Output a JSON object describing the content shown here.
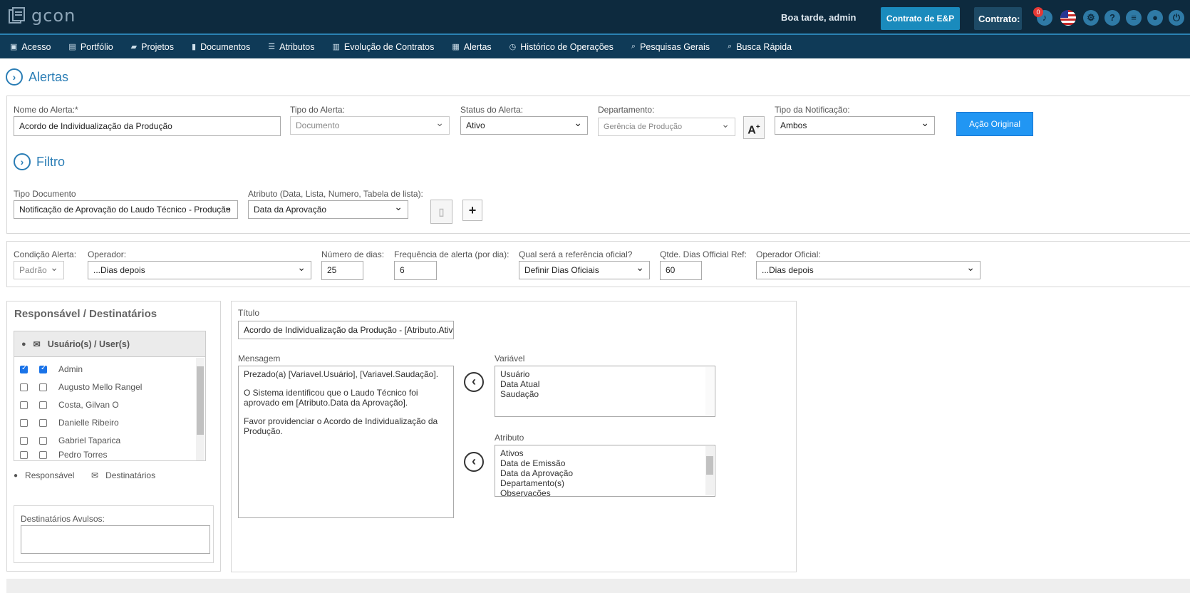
{
  "header": {
    "logo_text": "gcon",
    "greeting": "Boa tarde, admin",
    "contract_button": "Contrato de E&P",
    "contrato_label": "Contrato:",
    "notification_count": "0"
  },
  "nav": {
    "items": [
      {
        "label": "Acesso",
        "icon": "lock-icon",
        "glyph": "🔒"
      },
      {
        "label": "Portfólio",
        "icon": "portfolio-icon",
        "glyph": "▤"
      },
      {
        "label": "Projetos",
        "icon": "folder-icon",
        "glyph": "📂"
      },
      {
        "label": "Documentos",
        "icon": "document-icon",
        "glyph": "▮"
      },
      {
        "label": "Atributos",
        "icon": "list-icon",
        "glyph": "☰"
      },
      {
        "label": "Evolução de Contratos",
        "icon": "bar-chart-icon",
        "glyph": "▥"
      },
      {
        "label": "Alertas",
        "icon": "calendar-icon",
        "glyph": "▦"
      },
      {
        "label": "Histórico de Operações",
        "icon": "history-icon",
        "glyph": "◷"
      },
      {
        "label": "Pesquisas Gerais",
        "icon": "search-icon",
        "glyph": "🔍"
      },
      {
        "label": "Busca Rápida",
        "icon": "search-icon",
        "glyph": "🔍"
      }
    ]
  },
  "page": {
    "title": "Alertas",
    "filter_title": "Filtro"
  },
  "alert": {
    "name_label": "Nome do Alerta:*",
    "name_value": "Acordo de Individualização da Produção",
    "type_label": "Tipo do Alerta:",
    "type_value": "Documento",
    "status_label": "Status do Alerta:",
    "status_value": "Ativo",
    "department_label": "Departamento:",
    "department_value": "Gerência de Produção",
    "notification_label": "Tipo da Notificação:",
    "notification_value": "Ambos",
    "action_button": "Ação Original"
  },
  "filter": {
    "doc_type_label": "Tipo Documento",
    "doc_type_value": "Notificação de Aprovação do Laudo Técnico - Produção",
    "attribute_label": "Atributo (Data, Lista, Numero, Tabela de lista):",
    "attribute_value": "Data da Aprovação"
  },
  "condition": {
    "condition_label": "Condição Alerta:",
    "condition_value": "Padrão",
    "operator_label": "Operador:",
    "operator_value": "...Dias depois",
    "days_label": "Número de dias:",
    "days_value": "25",
    "frequency_label": "Frequência de alerta (por dia):",
    "frequency_value": "6",
    "reference_label": "Qual será a referência oficial?",
    "reference_value": "Definir Dias Oficiais",
    "official_days_label": "Qtde. Dias Official Ref:",
    "official_days_value": "60",
    "official_operator_label": "Operador Oficial:",
    "official_operator_value": "...Dias depois"
  },
  "recipients": {
    "title": "Responsável / Destinatários",
    "list_header": "Usuário(s) / User(s)",
    "users": [
      {
        "name": "Admin",
        "responsible": true,
        "recipient": true
      },
      {
        "name": "Augusto Mello Rangel",
        "responsible": false,
        "recipient": false
      },
      {
        "name": "Costa, Gilvan O",
        "responsible": false,
        "recipient": false
      },
      {
        "name": "Danielle Ribeiro",
        "responsible": false,
        "recipient": false
      },
      {
        "name": "Gabriel Taparica",
        "responsible": false,
        "recipient": false
      },
      {
        "name": "Pedro Torres",
        "responsible": false,
        "recipient": false
      }
    ],
    "legend_responsible": "Responsável",
    "legend_recipients": "Destinatários",
    "loose_label": "Destinatários Avulsos:",
    "loose_value": ""
  },
  "message": {
    "title_label": "Título",
    "title_value": "Acordo de Individualização da Produção - [Atributo.Ativo]",
    "message_label": "Mensagem",
    "message_lines": [
      "Prezado(a) [Variavel.Usuário], [Variavel.Saudação].",
      "",
      "O Sistema identificou que o Laudo Técnico foi",
      "aprovado em [Atributo.Data da Aprovação].",
      "",
      "Favor providenciar o Acordo de Individualização da",
      "Produção."
    ],
    "variable_label": "Variável",
    "variables": [
      "Usuário",
      "Data Atual",
      "Saudação"
    ],
    "attribute_label": "Atributo",
    "attributes": [
      "Ativos",
      "Data de Emissão",
      "Data da Aprovação",
      "Departamento(s)",
      "Observações"
    ]
  },
  "colors": {
    "topbar": "#0d2a3e",
    "navbar": "#0f3a57",
    "accent": "#2a7db5",
    "primary_button": "#2196f3"
  }
}
